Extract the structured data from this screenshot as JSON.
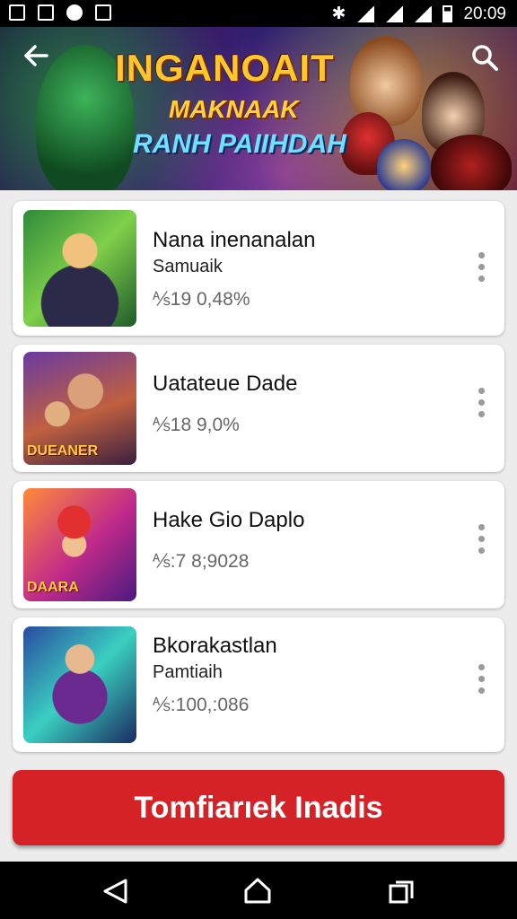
{
  "status_bar": {
    "time": "20:09"
  },
  "banner": {
    "logo_line1": "INGANOAIT",
    "logo_line2": "MAKNAAK",
    "logo_line3": "RANH PAIIHDAH"
  },
  "games": [
    {
      "title": "Nana inenanalan",
      "subtitle": "Samuaik",
      "stat": "⅍19 0,48%",
      "thumb_caption": ""
    },
    {
      "title": "Uatateue Dade",
      "subtitle": "",
      "stat": "⅍18 9,0%",
      "thumb_caption": "DUEANER"
    },
    {
      "title": "Hake Gio Daplo",
      "subtitle": "",
      "stat": "⅍:7 8;9028",
      "thumb_caption": "DAARA"
    },
    {
      "title": "Bkorakastlan",
      "subtitle": "Pamtiaih",
      "stat": "⅍:100,:086",
      "thumb_caption": ""
    }
  ],
  "cta": {
    "label": "Tomfiarıek Inadis"
  },
  "colors": {
    "cta": "#d42226",
    "card": "#ffffff",
    "background": "#ececec"
  },
  "icons": [
    "back-arrow-icon",
    "search-icon",
    "more-vert-icon",
    "nav-back-icon",
    "nav-home-icon",
    "nav-recents-icon"
  ]
}
